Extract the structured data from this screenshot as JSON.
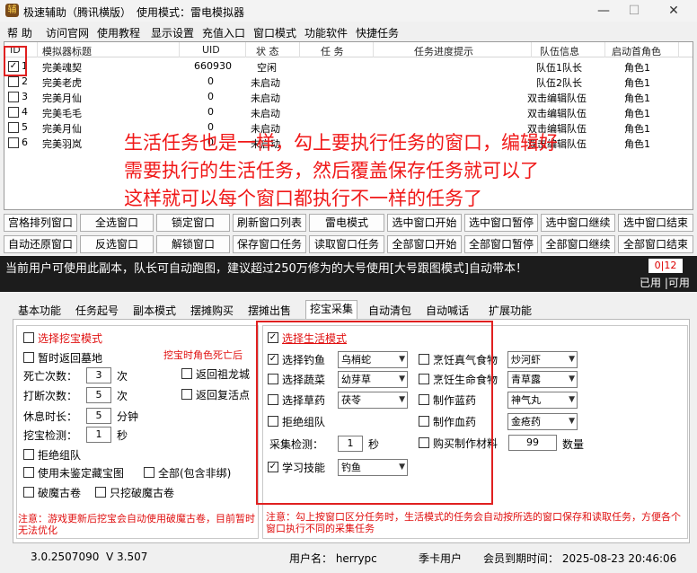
{
  "window": {
    "title": "极速辅助（腾讯横版）",
    "mode_label": "使用模式：雷电模拟器",
    "controls": [
      "—",
      "☐",
      "✕"
    ]
  },
  "menu": [
    "帮 助",
    "访问官网",
    "使用教程",
    "显示设置",
    "充值入口",
    "窗口模式",
    "功能软件",
    "快捷任务"
  ],
  "table": {
    "headers": [
      "ID",
      "模拟器标题",
      "UID",
      "状 态",
      "任 务",
      "任务进度提示",
      "队伍信息",
      "启动首角色"
    ],
    "rows": [
      {
        "id": "1",
        "title": "完美魂契",
        "uid": "660930",
        "status": "空闲",
        "task": "",
        "progress": "",
        "team": "队伍1队长",
        "role": "角色1"
      },
      {
        "id": "2",
        "title": "完美老虎",
        "uid": "0",
        "status": "未启动",
        "task": "",
        "progress": "",
        "team": "队伍2队长",
        "role": "角色1"
      },
      {
        "id": "3",
        "title": "完美月仙",
        "uid": "0",
        "status": "未启动",
        "task": "",
        "progress": "",
        "team": "双击编辑队伍",
        "role": "角色1"
      },
      {
        "id": "4",
        "title": "完美毛毛",
        "uid": "0",
        "status": "未启动",
        "task": "",
        "progress": "",
        "team": "双击编辑队伍",
        "role": "角色1"
      },
      {
        "id": "5",
        "title": "完美月仙",
        "uid": "0",
        "status": "未启动",
        "task": "",
        "progress": "",
        "team": "双击编辑队伍",
        "role": "角色1"
      },
      {
        "id": "6",
        "title": "完美羽岚",
        "uid": "0",
        "status": "未启动",
        "task": "",
        "progress": "",
        "team": "双击编辑队伍",
        "role": "角色1"
      }
    ]
  },
  "annotation": {
    "line1": "生活任务也是一样，勾上要执行任务的窗口，编辑好",
    "line2": "需要执行的生活任务，然后覆盖保存任务就可以了",
    "line3": "这样就可以每个窗口都执行不一样的任务了"
  },
  "buttons_row1": [
    "宫格排列窗口",
    "全选窗口",
    "锁定窗口",
    "刷新窗口列表",
    "雷电模式",
    "选中窗口开始",
    "选中窗口暂停",
    "选中窗口继续",
    "选中窗口结束"
  ],
  "buttons_row2": [
    "自动还原窗口",
    "反选窗口",
    "解锁窗口",
    "保存窗口任务",
    "读取窗口任务",
    "全部窗口开始",
    "全部窗口暂停",
    "全部窗口继续",
    "全部窗口结束"
  ],
  "notice": {
    "message": "当前用户可使用此副本，队长可自动跑图，建议超过250万修为的大号使用[大号跟图模式]自动带本！",
    "count": "0|12",
    "used": "已用 |可用"
  },
  "tabs": [
    "基本功能",
    "任务起号",
    "副本模式",
    "摆摊购买",
    "摆摊出售",
    "挖宝采集",
    "自动清包",
    "自动喊话",
    "扩展功能"
  ],
  "dig": {
    "mode": "选择挖宝模式",
    "return_grave": "暂时返回墓地",
    "death_note": "挖宝时角色死亡后",
    "death_label": "死亡次数：",
    "death_value": "3",
    "death_unit": "次",
    "return_dragon": "返回祖龙城",
    "hit_label": "打断次数：",
    "hit_value": "5",
    "hit_unit": "次",
    "return_revive": "返回复活点",
    "rest_label": "休息时长：",
    "rest_value": "5",
    "rest_unit": "分钟",
    "detect_label": "挖宝检测：",
    "detect_value": "1",
    "detect_unit": "秒",
    "refuse_team": "拒绝组队",
    "use_unid": "使用未鉴定藏宝图",
    "all_unbind": "全部(包含非绑)",
    "break_scroll": "破魔古卷",
    "only_break": "只挖破魔古卷",
    "warn": "注意：游戏更新后挖宝会自动使用破魔古卷，目前暂时无法优化"
  },
  "life": {
    "mode": "选择生活模式",
    "fish_label": "选择钓鱼",
    "fish_value": "乌梢蛇",
    "herb_label": "选择蔬菜",
    "herb_value": "幼芽草",
    "grass_label": "选择草药",
    "grass_value": "茯苓",
    "refuse_team": "拒绝组队",
    "detect_label": "采集检测：",
    "detect_value": "1",
    "detect_unit": "秒",
    "learn_label": "学习技能",
    "learn_value": "钓鱼",
    "cook1_label": "烹饪真气食物",
    "cook1_value": "炒河虾",
    "cook2_label": "烹饪生命食物",
    "cook2_value": "青草露",
    "blue_label": "制作蓝药",
    "blue_value": "神气丸",
    "red_label": "制作血药",
    "red_value": "金疮药",
    "buy_label": "购买制作材料",
    "buy_value": "99",
    "buy_unit": "数量",
    "warn": "注意：勾上按窗口区分任务时，生活模式的任务会自动按所选的窗口保存和读取任务，方便各个窗口执行不同的采集任务"
  },
  "status": {
    "version": "3.0.2507090",
    "v": "V 3.507",
    "user": "用户名：  herrypc",
    "card": "季卡用户",
    "expire": "会员到期时间：  2025-08-23 20:46:06"
  }
}
